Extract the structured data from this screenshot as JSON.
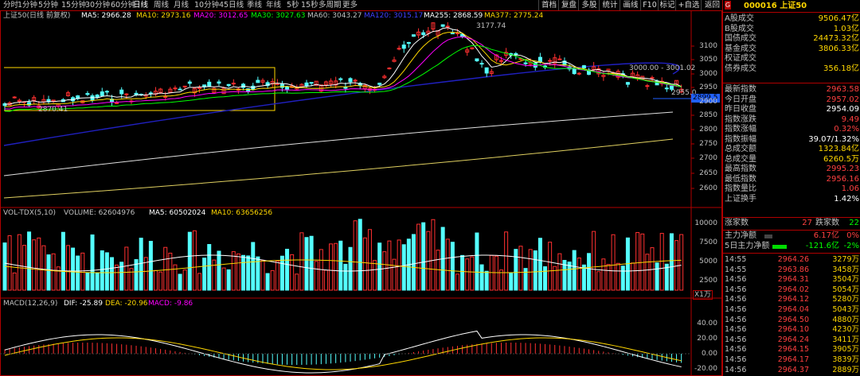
{
  "toolbar": {
    "tabs": [
      "分时",
      "1分钟",
      "5分钟",
      "15分钟",
      "30分钟",
      "60分钟",
      "日线",
      "周线",
      "月线",
      "10分钟",
      "45日线",
      "季线",
      "年线",
      "5秒",
      "15秒",
      "多周期",
      "更多"
    ],
    "active_tab": "日线",
    "buttons": [
      "首档",
      "复盘",
      "多股",
      "统计",
      "画线",
      "F10",
      "标记",
      "+自选",
      "返回"
    ]
  },
  "price_chart": {
    "title": "上证50(日线 前复权)",
    "ma_labels": [
      {
        "text": "MA5: 2966.28",
        "color": "#ffffff"
      },
      {
        "text": "MA10: 2973.16",
        "color": "#ffd700"
      },
      {
        "text": "MA20: 3012.65",
        "color": "#ff00ff"
      },
      {
        "text": "MA30: 3027.63",
        "color": "#00ff00"
      },
      {
        "text": "MA60: 3043.27",
        "color": "#c0c0c0"
      },
      {
        "text": "MA120: 3015.17",
        "color": "#4040ff"
      },
      {
        "text": "MA255: 2868.59",
        "color": "#ffffff"
      },
      {
        "text": "MA377: 2775.24",
        "color": "#ffd700"
      }
    ],
    "y_ticks": [
      "3100",
      "3050",
      "3000",
      "2950",
      "2900",
      "2850",
      "2800",
      "2750",
      "2700",
      "2650",
      "2600"
    ],
    "annotations": {
      "high": "3177.74",
      "low": "2870.41",
      "range": "3000.00 - 3001.02",
      "last": "2955.0",
      "current_price_tag": "2899.5"
    }
  },
  "volume_chart": {
    "title": "VOL-TDX(5,10)",
    "labels": [
      {
        "text": "VOLUME: 62604976",
        "color": "#c0c0c0"
      },
      {
        "text": "MA5: 60502024",
        "color": "#ffffff"
      },
      {
        "text": "MA10: 63656256",
        "color": "#ffd700"
      }
    ],
    "y_ticks": [
      "10000",
      "7500",
      "5000",
      "2500"
    ],
    "unit": "X1万"
  },
  "macd_chart": {
    "title": "MACD(12,26,9)",
    "labels": [
      {
        "text": "DIF: -25.89",
        "color": "#ffffff"
      },
      {
        "text": "DEA: -20.96",
        "color": "#ffd700"
      },
      {
        "text": "MACD: -9.86",
        "color": "#ff00ff"
      }
    ],
    "y_ticks": [
      "40.00",
      "20.00",
      "0.00",
      "-20.00"
    ]
  },
  "quote": {
    "g_badge": "G",
    "code_name": "000016 上证50",
    "rows1": [
      {
        "k": "A股成交",
        "v": "9506.47亿",
        "c": "#ffd700"
      },
      {
        "k": "B股成交",
        "v": "1.03亿",
        "c": "#ffd700"
      },
      {
        "k": "国债成交",
        "v": "24473.32亿",
        "c": "#ffd700"
      },
      {
        "k": "基金成交",
        "v": "3806.33亿",
        "c": "#ffd700"
      },
      {
        "k": "权证成交",
        "v": "",
        "c": "#ffd700"
      },
      {
        "k": "债券成交",
        "v": "356.18亿",
        "c": "#ffd700"
      }
    ],
    "rows2": [
      {
        "k": "最新指数",
        "v": "2963.58",
        "c": "#ff4040"
      },
      {
        "k": "今日开盘",
        "v": "2957.02",
        "c": "#ff4040"
      },
      {
        "k": "昨日收盘",
        "v": "2954.09",
        "c": "#ffffff"
      },
      {
        "k": "指数涨跌",
        "v": "9.49",
        "c": "#ff4040"
      },
      {
        "k": "指数涨幅",
        "v": "0.32%",
        "c": "#ff4040"
      },
      {
        "k": "指数振幅",
        "v": "39.07/1.32%",
        "c": "#ffffff"
      },
      {
        "k": "总成交额",
        "v": "1323.84亿",
        "c": "#ffd700"
      },
      {
        "k": "总成交量",
        "v": "6260.5万",
        "c": "#ffd700"
      },
      {
        "k": "最高指数",
        "v": "2995.23",
        "c": "#ff4040"
      },
      {
        "k": "最低指数",
        "v": "2956.16",
        "c": "#ff4040"
      },
      {
        "k": "指数量比",
        "v": "1.06",
        "c": "#ff4040"
      },
      {
        "k": "上证换手",
        "v": "1.42%",
        "c": "#ffffff"
      }
    ],
    "rise_fall": {
      "rise_label": "涨家数",
      "rise": "27",
      "fall_label": "跌家数",
      "fall": "22"
    },
    "main_flow": {
      "label": "主力净额",
      "value": "6.17亿",
      "pct": "0%"
    },
    "main_flow5": {
      "label": "5日主力净额",
      "value": "-121.6亿",
      "pct": "-2%"
    },
    "trades": [
      {
        "t": "14:55",
        "p": "2964.26",
        "v": "3279万"
      },
      {
        "t": "14:55",
        "p": "2963.86",
        "v": "3458万"
      },
      {
        "t": "14:56",
        "p": "2964.31",
        "v": "3504万"
      },
      {
        "t": "14:56",
        "p": "2964.02",
        "v": "5054万"
      },
      {
        "t": "14:56",
        "p": "2964.12",
        "v": "5280万"
      },
      {
        "t": "14:56",
        "p": "2964.04",
        "v": "5043万"
      },
      {
        "t": "14:56",
        "p": "2964.50",
        "v": "4880万"
      },
      {
        "t": "14:56",
        "p": "2964.10",
        "v": "4230万"
      },
      {
        "t": "14:56",
        "p": "2964.24",
        "v": "3411万"
      },
      {
        "t": "14:56",
        "p": "2964.15",
        "v": "3905万"
      },
      {
        "t": "14:56",
        "p": "2964.17",
        "v": "3839万"
      },
      {
        "t": "14:56",
        "p": "2964.37",
        "v": "2889万"
      }
    ]
  },
  "colors": {
    "up": "#ff3030",
    "down": "#54ffff",
    "frame": "#b00000",
    "yellow": "#ffd700"
  }
}
